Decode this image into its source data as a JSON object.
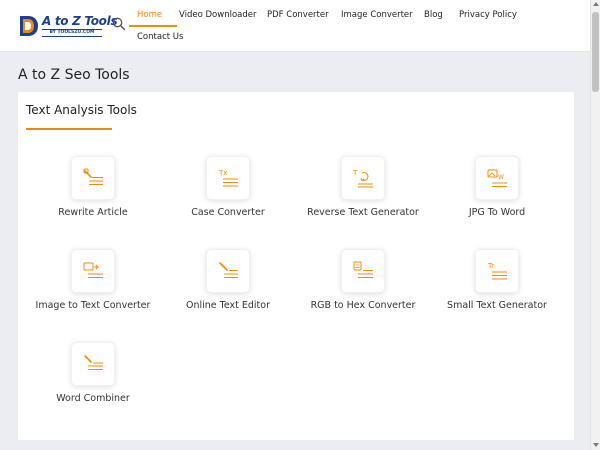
{
  "header": {
    "logo": {
      "title": "A to Z Tools",
      "subtitle": "BY TOOLSZU.COM"
    },
    "search_icon": "search-icon",
    "nav": [
      {
        "label": "Home",
        "active": true
      },
      {
        "label": "Video Downloader",
        "active": false
      },
      {
        "label": "PDF Converter",
        "active": false
      },
      {
        "label": "Image Converter",
        "active": false
      },
      {
        "label": "Blog",
        "active": false
      },
      {
        "label": "Privacy Policy",
        "active": false
      },
      {
        "label": "Contact Us",
        "active": false
      }
    ]
  },
  "main": {
    "page_title": "A to Z Seo Tools",
    "section_title": "Text Analysis Tools",
    "tools": [
      {
        "label": "Rewrite Article",
        "icon": "rewrite-article-icon"
      },
      {
        "label": "Case Converter",
        "icon": "case-converter-icon"
      },
      {
        "label": "Reverse Text Generator",
        "icon": "reverse-text-icon"
      },
      {
        "label": "JPG To Word",
        "icon": "jpg-to-word-icon"
      },
      {
        "label": "Image to Text Converter",
        "icon": "image-to-text-icon"
      },
      {
        "label": "Online Text Editor",
        "icon": "text-editor-icon"
      },
      {
        "label": "RGB to Hex Converter",
        "icon": "rgb-to-hex-icon"
      },
      {
        "label": "Small Text Generator",
        "icon": "small-text-icon"
      },
      {
        "label": "Word Combiner",
        "icon": "word-combiner-icon"
      }
    ]
  },
  "colors": {
    "accent": "#f0890f",
    "brand": "#1c3f8f",
    "background": "#ebedf2"
  }
}
